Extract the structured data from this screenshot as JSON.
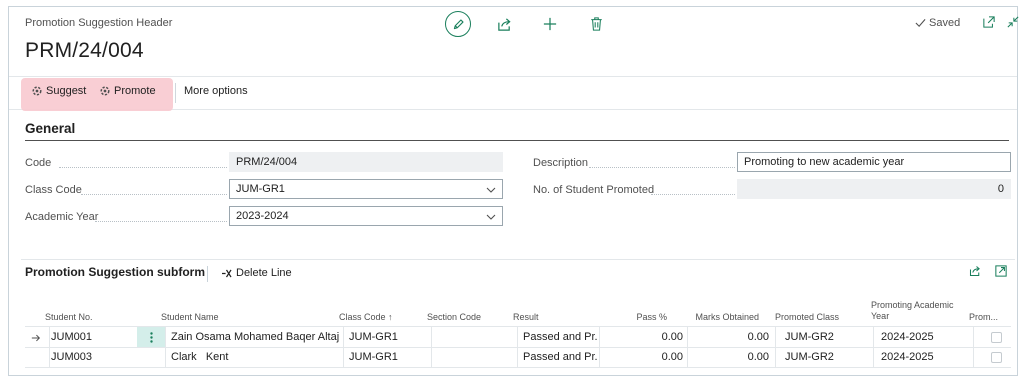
{
  "page": {
    "caption": "Promotion Suggestion Header",
    "record_no": "PRM/24/004",
    "saved_label": "Saved"
  },
  "icons": {
    "top": [
      "edit-icon",
      "share-icon",
      "plus-icon",
      "delete-icon"
    ],
    "window": [
      "open-new-window-icon",
      "collapse-icon"
    ]
  },
  "actions": {
    "suggest": "Suggest",
    "promote": "Promote",
    "more_options": "More options"
  },
  "general": {
    "title": "General",
    "code_label": "Code",
    "code_value": "PRM/24/004",
    "class_code_label": "Class Code",
    "class_code_value": "JUM-GR1",
    "academic_year_label": "Academic Year",
    "academic_year_value": "2023-2024",
    "description_label": "Description",
    "description_value": "Promoting to new academic year",
    "promoted_count_label": "No. of Student Promoted",
    "promoted_count_value": "0"
  },
  "subform": {
    "title": "Promotion Suggestion subform",
    "delete_line": "Delete Line",
    "columns": {
      "student_no": "Student No.",
      "student_name": "Student Name",
      "class_code": "Class Code ↑",
      "section_code": "Section Code",
      "result": "Result",
      "pass_pct": "Pass %",
      "marks": "Marks Obtained",
      "promoted_class": "Promoted Class",
      "promoting_year": "Promoting Academic Year",
      "prom": "Prom..."
    },
    "rows": [
      {
        "student_no": "JUM001",
        "student_name": "Zain Osama Mohamed Baqer Altajer",
        "class_code": "JUM-GR1",
        "section_code": "",
        "result": "Passed and Pr...",
        "pass_pct": "0.00",
        "marks": "0.00",
        "promoted_class": "JUM-GR2",
        "promoting_year": "2024-2025"
      },
      {
        "student_no": "JUM003",
        "student_name": "Clark   Kent",
        "class_code": "JUM-GR1",
        "section_code": "",
        "result": "Passed and Pr...",
        "pass_pct": "0.00",
        "marks": "0.00",
        "promoted_class": "JUM-GR2",
        "promoting_year": "2024-2025"
      }
    ]
  },
  "colors": {
    "accent": "#1a7f5c",
    "highlight": "#f8c9cf",
    "selected_cell": "#d4eeea"
  }
}
